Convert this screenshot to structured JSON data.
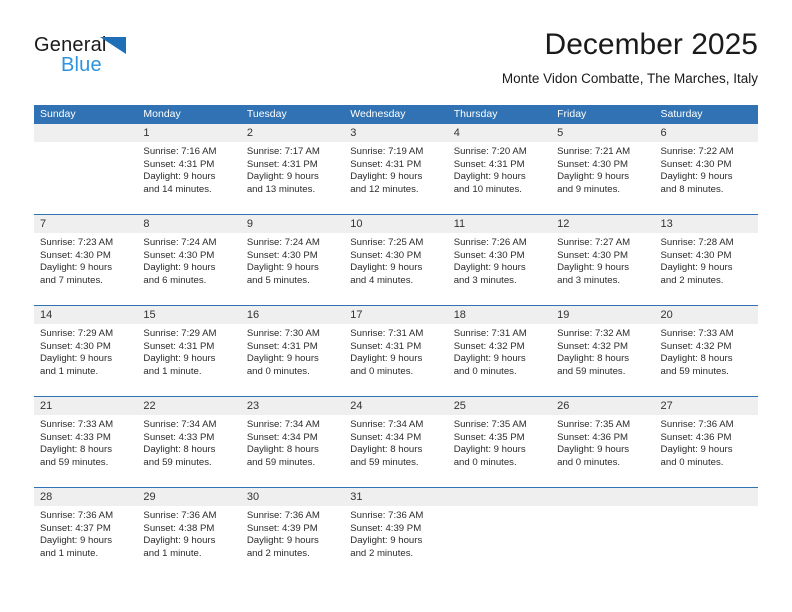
{
  "brand": {
    "line1": "General",
    "line2": "Blue",
    "triangle_color": "#1e6fb6",
    "line2_color": "#2e93e0"
  },
  "header": {
    "title": "December 2025",
    "subtitle": "Monte Vidon Combatte, The Marches, Italy"
  },
  "theme": {
    "header_blue": "#3072b3",
    "daynum_band": "#efefef",
    "text": "#2b2b2b"
  },
  "weekdays": [
    "Sunday",
    "Monday",
    "Tuesday",
    "Wednesday",
    "Thursday",
    "Friday",
    "Saturday"
  ],
  "weeks": [
    [
      {
        "day": ""
      },
      {
        "day": "1",
        "sunrise": "Sunrise: 7:16 AM",
        "sunset": "Sunset: 4:31 PM",
        "daylight1": "Daylight: 9 hours",
        "daylight2": "and 14 minutes."
      },
      {
        "day": "2",
        "sunrise": "Sunrise: 7:17 AM",
        "sunset": "Sunset: 4:31 PM",
        "daylight1": "Daylight: 9 hours",
        "daylight2": "and 13 minutes."
      },
      {
        "day": "3",
        "sunrise": "Sunrise: 7:19 AM",
        "sunset": "Sunset: 4:31 PM",
        "daylight1": "Daylight: 9 hours",
        "daylight2": "and 12 minutes."
      },
      {
        "day": "4",
        "sunrise": "Sunrise: 7:20 AM",
        "sunset": "Sunset: 4:31 PM",
        "daylight1": "Daylight: 9 hours",
        "daylight2": "and 10 minutes."
      },
      {
        "day": "5",
        "sunrise": "Sunrise: 7:21 AM",
        "sunset": "Sunset: 4:30 PM",
        "daylight1": "Daylight: 9 hours",
        "daylight2": "and 9 minutes."
      },
      {
        "day": "6",
        "sunrise": "Sunrise: 7:22 AM",
        "sunset": "Sunset: 4:30 PM",
        "daylight1": "Daylight: 9 hours",
        "daylight2": "and 8 minutes."
      }
    ],
    [
      {
        "day": "7",
        "sunrise": "Sunrise: 7:23 AM",
        "sunset": "Sunset: 4:30 PM",
        "daylight1": "Daylight: 9 hours",
        "daylight2": "and 7 minutes."
      },
      {
        "day": "8",
        "sunrise": "Sunrise: 7:24 AM",
        "sunset": "Sunset: 4:30 PM",
        "daylight1": "Daylight: 9 hours",
        "daylight2": "and 6 minutes."
      },
      {
        "day": "9",
        "sunrise": "Sunrise: 7:24 AM",
        "sunset": "Sunset: 4:30 PM",
        "daylight1": "Daylight: 9 hours",
        "daylight2": "and 5 minutes."
      },
      {
        "day": "10",
        "sunrise": "Sunrise: 7:25 AM",
        "sunset": "Sunset: 4:30 PM",
        "daylight1": "Daylight: 9 hours",
        "daylight2": "and 4 minutes."
      },
      {
        "day": "11",
        "sunrise": "Sunrise: 7:26 AM",
        "sunset": "Sunset: 4:30 PM",
        "daylight1": "Daylight: 9 hours",
        "daylight2": "and 3 minutes."
      },
      {
        "day": "12",
        "sunrise": "Sunrise: 7:27 AM",
        "sunset": "Sunset: 4:30 PM",
        "daylight1": "Daylight: 9 hours",
        "daylight2": "and 3 minutes."
      },
      {
        "day": "13",
        "sunrise": "Sunrise: 7:28 AM",
        "sunset": "Sunset: 4:30 PM",
        "daylight1": "Daylight: 9 hours",
        "daylight2": "and 2 minutes."
      }
    ],
    [
      {
        "day": "14",
        "sunrise": "Sunrise: 7:29 AM",
        "sunset": "Sunset: 4:30 PM",
        "daylight1": "Daylight: 9 hours",
        "daylight2": "and 1 minute."
      },
      {
        "day": "15",
        "sunrise": "Sunrise: 7:29 AM",
        "sunset": "Sunset: 4:31 PM",
        "daylight1": "Daylight: 9 hours",
        "daylight2": "and 1 minute."
      },
      {
        "day": "16",
        "sunrise": "Sunrise: 7:30 AM",
        "sunset": "Sunset: 4:31 PM",
        "daylight1": "Daylight: 9 hours",
        "daylight2": "and 0 minutes."
      },
      {
        "day": "17",
        "sunrise": "Sunrise: 7:31 AM",
        "sunset": "Sunset: 4:31 PM",
        "daylight1": "Daylight: 9 hours",
        "daylight2": "and 0 minutes."
      },
      {
        "day": "18",
        "sunrise": "Sunrise: 7:31 AM",
        "sunset": "Sunset: 4:32 PM",
        "daylight1": "Daylight: 9 hours",
        "daylight2": "and 0 minutes."
      },
      {
        "day": "19",
        "sunrise": "Sunrise: 7:32 AM",
        "sunset": "Sunset: 4:32 PM",
        "daylight1": "Daylight: 8 hours",
        "daylight2": "and 59 minutes."
      },
      {
        "day": "20",
        "sunrise": "Sunrise: 7:33 AM",
        "sunset": "Sunset: 4:32 PM",
        "daylight1": "Daylight: 8 hours",
        "daylight2": "and 59 minutes."
      }
    ],
    [
      {
        "day": "21",
        "sunrise": "Sunrise: 7:33 AM",
        "sunset": "Sunset: 4:33 PM",
        "daylight1": "Daylight: 8 hours",
        "daylight2": "and 59 minutes."
      },
      {
        "day": "22",
        "sunrise": "Sunrise: 7:34 AM",
        "sunset": "Sunset: 4:33 PM",
        "daylight1": "Daylight: 8 hours",
        "daylight2": "and 59 minutes."
      },
      {
        "day": "23",
        "sunrise": "Sunrise: 7:34 AM",
        "sunset": "Sunset: 4:34 PM",
        "daylight1": "Daylight: 8 hours",
        "daylight2": "and 59 minutes."
      },
      {
        "day": "24",
        "sunrise": "Sunrise: 7:34 AM",
        "sunset": "Sunset: 4:34 PM",
        "daylight1": "Daylight: 8 hours",
        "daylight2": "and 59 minutes."
      },
      {
        "day": "25",
        "sunrise": "Sunrise: 7:35 AM",
        "sunset": "Sunset: 4:35 PM",
        "daylight1": "Daylight: 9 hours",
        "daylight2": "and 0 minutes."
      },
      {
        "day": "26",
        "sunrise": "Sunrise: 7:35 AM",
        "sunset": "Sunset: 4:36 PM",
        "daylight1": "Daylight: 9 hours",
        "daylight2": "and 0 minutes."
      },
      {
        "day": "27",
        "sunrise": "Sunrise: 7:36 AM",
        "sunset": "Sunset: 4:36 PM",
        "daylight1": "Daylight: 9 hours",
        "daylight2": "and 0 minutes."
      }
    ],
    [
      {
        "day": "28",
        "sunrise": "Sunrise: 7:36 AM",
        "sunset": "Sunset: 4:37 PM",
        "daylight1": "Daylight: 9 hours",
        "daylight2": "and 1 minute."
      },
      {
        "day": "29",
        "sunrise": "Sunrise: 7:36 AM",
        "sunset": "Sunset: 4:38 PM",
        "daylight1": "Daylight: 9 hours",
        "daylight2": "and 1 minute."
      },
      {
        "day": "30",
        "sunrise": "Sunrise: 7:36 AM",
        "sunset": "Sunset: 4:39 PM",
        "daylight1": "Daylight: 9 hours",
        "daylight2": "and 2 minutes."
      },
      {
        "day": "31",
        "sunrise": "Sunrise: 7:36 AM",
        "sunset": "Sunset: 4:39 PM",
        "daylight1": "Daylight: 9 hours",
        "daylight2": "and 2 minutes."
      },
      {
        "day": ""
      },
      {
        "day": ""
      },
      {
        "day": ""
      }
    ]
  ]
}
